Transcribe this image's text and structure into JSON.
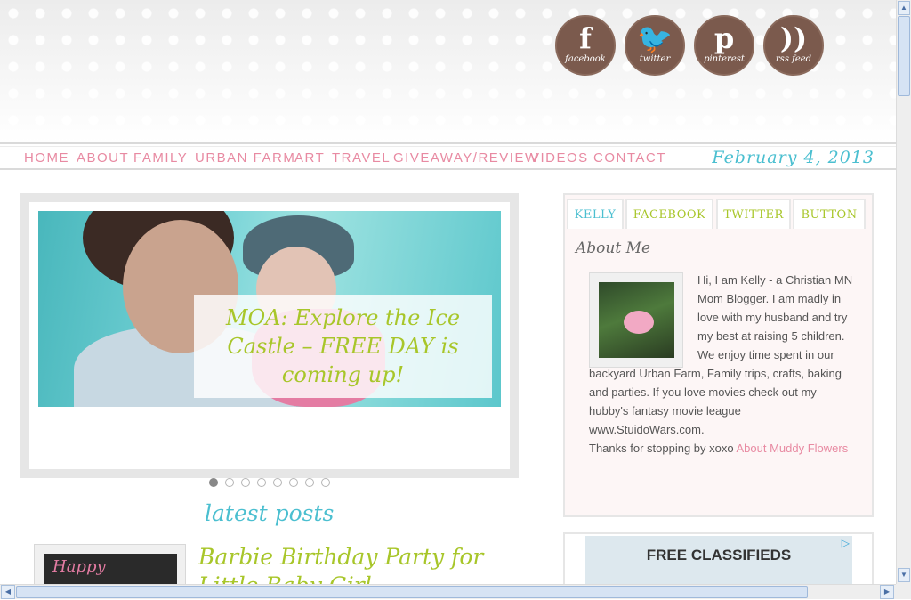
{
  "social": [
    {
      "glyph": "f",
      "label": "facebook",
      "icon": "facebook-icon"
    },
    {
      "glyph": "t",
      "label": "twitter",
      "icon": "twitter-icon"
    },
    {
      "glyph": "p",
      "label": "pinterest",
      "icon": "pinterest-icon"
    },
    {
      "glyph": "))",
      "label": "rss feed",
      "icon": "rss-icon"
    }
  ],
  "nav": [
    "HOME",
    "ABOUT",
    "FAMILY",
    "URBAN FARM",
    "ART",
    "TRAVEL",
    "GIVEAWAY/REVIEW",
    "VIDEOS",
    "CONTACT"
  ],
  "date": "February 4, 2013",
  "slider": {
    "caption": "MOA: Explore the Ice Castle – FREE DAY is coming up!",
    "slide_count": 8,
    "active_index": 0
  },
  "latest_heading": "latest posts",
  "latest_post": {
    "title": "Barbie Birthday Party for Little Baby Girl",
    "thumb_text": "Happy"
  },
  "sidebar": {
    "tabs": [
      "KELLY",
      "FACEBOOK",
      "TWITTER",
      "BUTTON"
    ],
    "active_tab": 0,
    "about_title": "About Me",
    "about_text": "Hi, I am Kelly - a Christian MN Mom Blogger. I am madly in love with my husband and try my best at raising 5 children. We enjoy time spent in our backyard Urban Farm, Family trips, crafts, baking and parties. If you love movies check out my hubby's fantasy movie league www.StuidoWars.com.",
    "thanks_text": "Thanks for stopping by xoxo ",
    "about_link": "About Muddy Flowers"
  },
  "ad": {
    "title": "FREE CLASSIFIEDS",
    "choice_icon": "adchoices-icon"
  },
  "colors": {
    "pink": "#e88aa2",
    "teal": "#4bbfd0",
    "green": "#a8c62a",
    "brown": "#7b5a4d"
  }
}
